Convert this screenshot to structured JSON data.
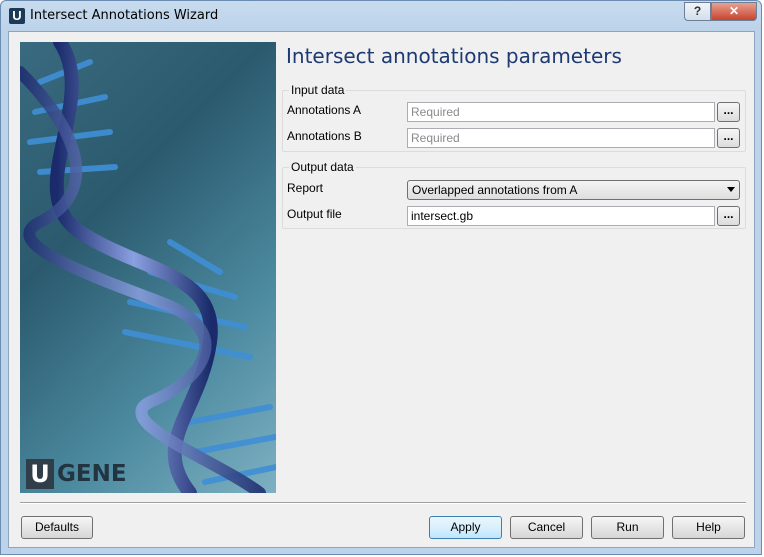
{
  "window": {
    "title": "Intersect Annotations Wizard",
    "app_icon_letter": "U",
    "help_symbol": "?",
    "close_symbol": "✕"
  },
  "banner": {
    "logo_letter": "U",
    "logo_text": "GENE",
    "accent_color": "#2b5a6e"
  },
  "page": {
    "title": "Intersect annotations parameters"
  },
  "input_group": {
    "title": "Input data",
    "annotations_a": {
      "label": "Annotations A",
      "value": "",
      "placeholder": "Required",
      "browse": "..."
    },
    "annotations_b": {
      "label": "Annotations B",
      "value": "",
      "placeholder": "Required",
      "browse": "..."
    }
  },
  "output_group": {
    "title": "Output data",
    "report": {
      "label": "Report",
      "selected": "Overlapped annotations from A"
    },
    "output_file": {
      "label": "Output file",
      "value": "intersect.gb",
      "browse": "..."
    }
  },
  "buttons": {
    "defaults": "Defaults",
    "apply": "Apply",
    "cancel": "Cancel",
    "run": "Run",
    "help": "Help"
  }
}
